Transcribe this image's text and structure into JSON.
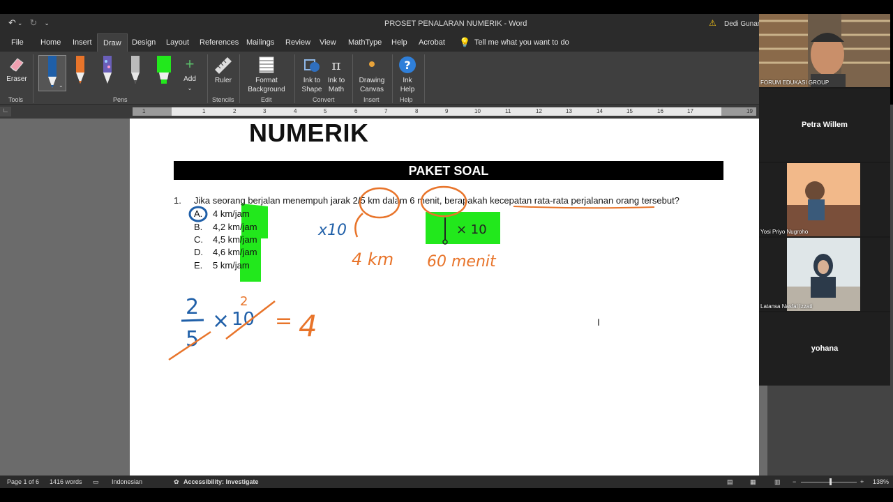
{
  "window": {
    "title": "PROSET PENALARAN NUMERIK  -  Word",
    "user": "Dedi Gunarto"
  },
  "menu": {
    "tabs": [
      "File",
      "Home",
      "Insert",
      "Draw",
      "Design",
      "Layout",
      "References",
      "Mailings",
      "Review",
      "View",
      "MathType",
      "Help",
      "Acrobat"
    ],
    "active": "Draw",
    "tell_me": "Tell me what you want to do"
  },
  "ribbon": {
    "eraser": "Eraser",
    "add": "Add",
    "ruler": "Ruler",
    "format_background": "Format Background",
    "ink_to_shape": "Ink to Shape",
    "ink_to_math": "Ink to Math",
    "drawing_canvas": "Drawing Canvas",
    "ink_help": "Ink Help",
    "groups": {
      "tools": "Tools",
      "pens": "Pens",
      "stencils": "Stencils",
      "edit": "Edit",
      "convert": "Convert",
      "insert": "Insert",
      "help": "Help"
    },
    "pen_colors": [
      "#1f5fa8",
      "#e8742a",
      "#8a6fc9",
      "#cccccc",
      "#22e81c"
    ]
  },
  "ruler_ticks": [
    "1",
    "1",
    "2",
    "3",
    "4",
    "5",
    "6",
    "7",
    "8",
    "9",
    "10",
    "11",
    "12",
    "13",
    "14",
    "15",
    "16",
    "17",
    "19"
  ],
  "document": {
    "heading": "NUMERIK",
    "banner": "PAKET SOAL",
    "question_number": "1.",
    "question_text": "Jika seorang berjalan menempuh jarak 2/5 km dalam 6 menit, berapakah kecepatan rata-rata perjalanan orang tersebut?",
    "options": [
      {
        "letter": "A.",
        "value": "4 km/jam"
      },
      {
        "letter": "B.",
        "value": "4,2 km/jam"
      },
      {
        "letter": "C.",
        "value": "4,5 km/jam"
      },
      {
        "letter": "D.",
        "value": "4,6 km/jam"
      },
      {
        "letter": "E.",
        "value": "5 km/jam"
      }
    ],
    "selected_option": "A",
    "highlight_color": "#22e81c",
    "ink_orange": "#e8742a",
    "ink_blue": "#1f5fa8",
    "annotations": {
      "x10_blue": "x10",
      "x10_box": "× 10",
      "km4": "4 km",
      "minutes60": "60 menit",
      "frac_num": "2",
      "frac_den": "5",
      "times": "×",
      "ten": "10",
      "small_two": "2",
      "equals": "=",
      "result": "4"
    }
  },
  "status": {
    "page": "Page 1 of 6",
    "words": "1416 words",
    "language": "Indonesian",
    "accessibility": "Accessibility: Investigate",
    "zoom": "138%"
  },
  "participants": [
    {
      "name": "FORUM EDUKASI GROUP",
      "video": true
    },
    {
      "name": "Petra Willem",
      "video": false
    },
    {
      "name": "Yosi Priyo Nugroho",
      "video": true
    },
    {
      "name": "Latansa Nasfal Izzati",
      "video": true
    },
    {
      "name": "yohana",
      "video": false
    }
  ]
}
